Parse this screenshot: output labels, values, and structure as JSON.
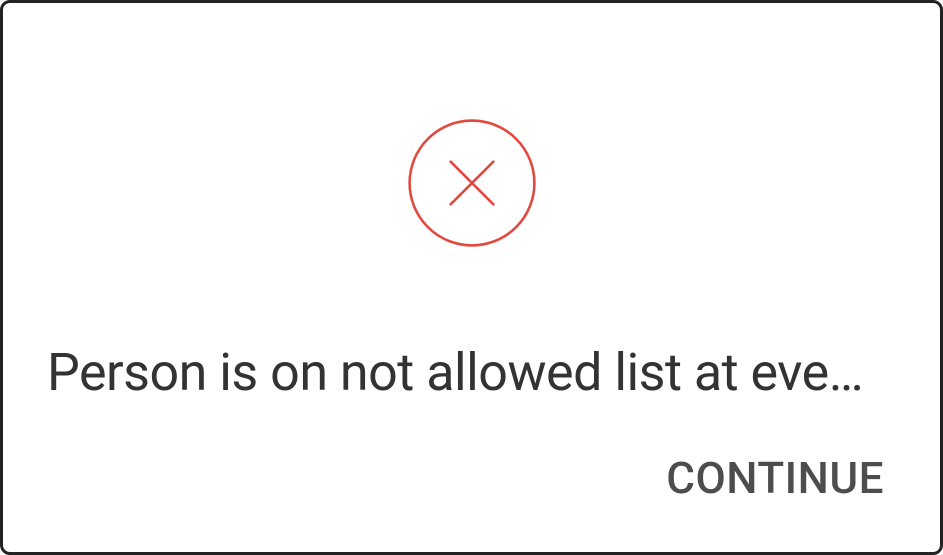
{
  "dialog": {
    "icon": "error-x-circle",
    "icon_color": "#e04a3f",
    "message": "Person is on not allowed list at eve…",
    "actions": {
      "continue_label": "CONTINUE"
    }
  }
}
